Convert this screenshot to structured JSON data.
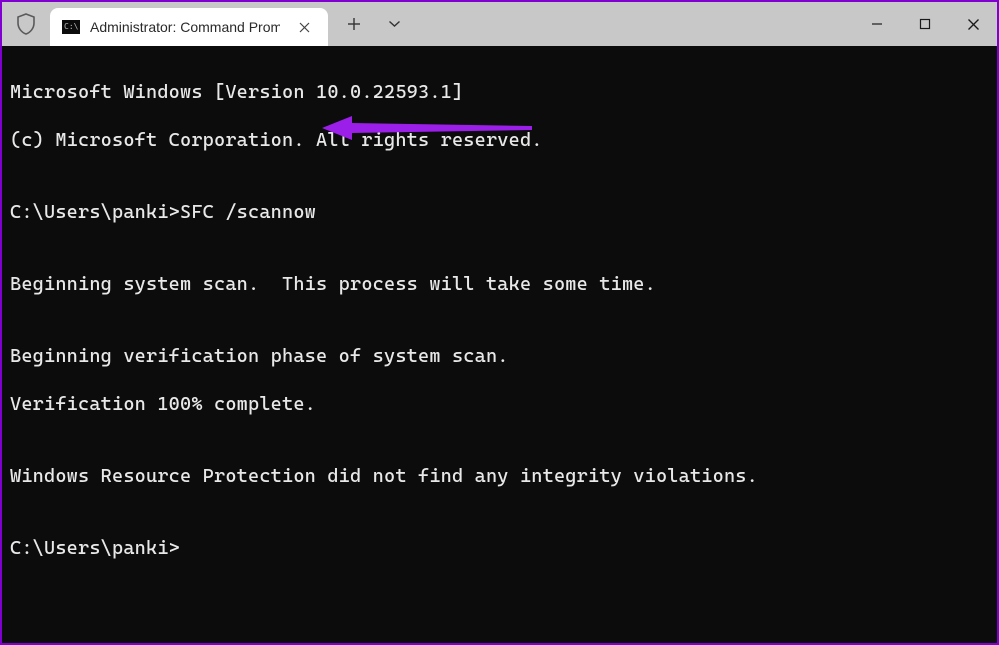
{
  "titlebar": {
    "tab_title": "Administrator: Command Promp",
    "icons": {
      "shield": "shield-icon",
      "cmd": "cmd-icon",
      "close_tab": "close-icon",
      "new_tab": "plus-icon",
      "dropdown": "chevron-down-icon",
      "minimize": "minimize-icon",
      "maximize": "maximize-icon",
      "close_window": "close-icon"
    }
  },
  "terminal": {
    "lines": [
      "Microsoft Windows [Version 10.0.22593.1]",
      "(c) Microsoft Corporation. All rights reserved.",
      "",
      "C:\\Users\\panki>SFC /scannow",
      "",
      "Beginning system scan.  This process will take some time.",
      "",
      "Beginning verification phase of system scan.",
      "Verification 100% complete.",
      "",
      "Windows Resource Protection did not find any integrity violations.",
      "",
      "C:\\Users\\panki>"
    ]
  },
  "annotation": {
    "arrow_color": "#9b1fe8"
  }
}
